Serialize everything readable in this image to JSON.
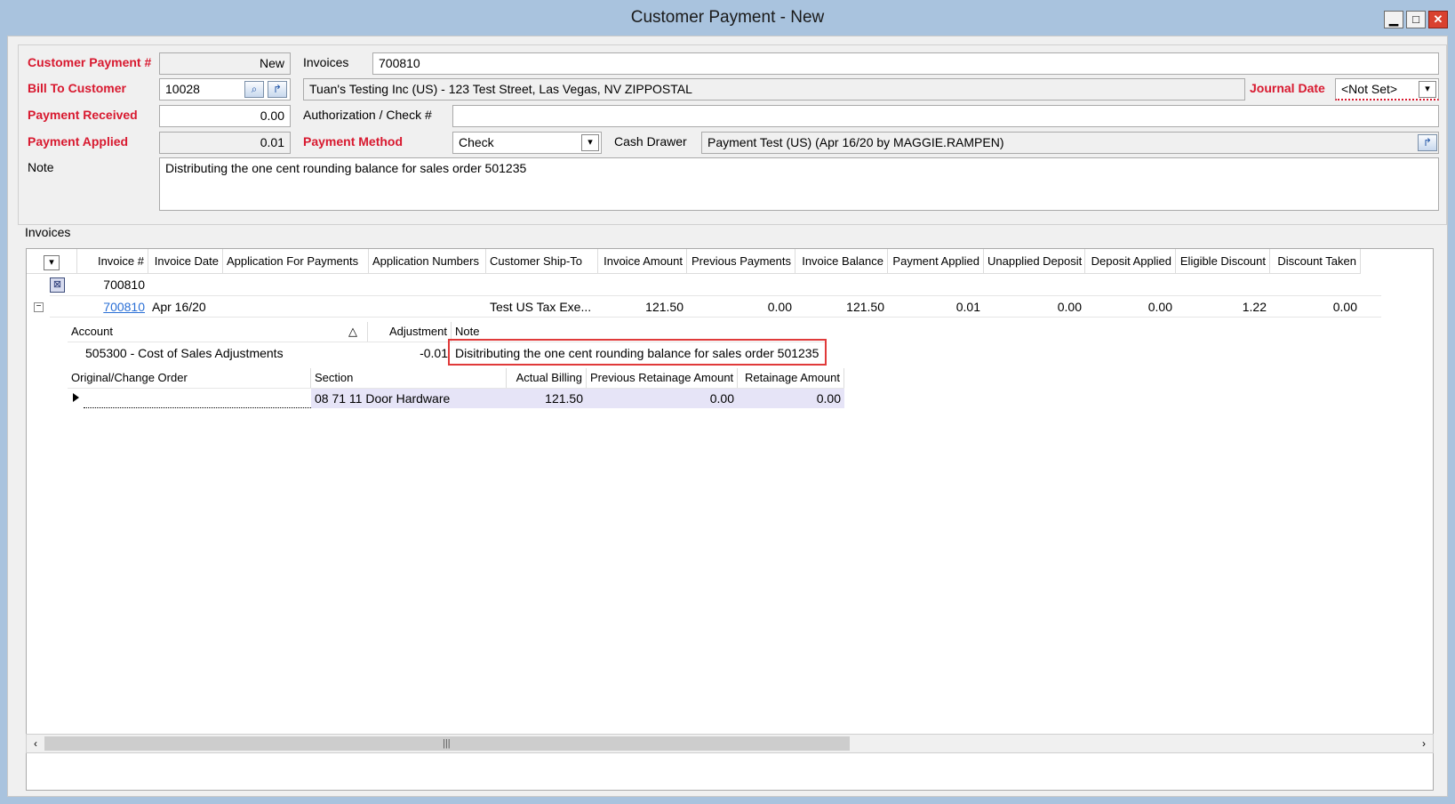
{
  "window": {
    "title": "Customer Payment - New",
    "minimize_icon": "minimize-icon",
    "maximize_icon": "maximize-icon",
    "close_icon": "close-icon"
  },
  "header": {
    "customer_payment_label": "Customer Payment #",
    "customer_payment_value": "New",
    "invoices_label": "Invoices",
    "invoices_value": "700810",
    "bill_to_label": "Bill To Customer",
    "bill_to_value": "10028",
    "bill_to_description": "Tuan's Testing Inc (US) - 123 Test Street, Las Vegas, NV  ZIPPOSTAL",
    "journal_date_label": "Journal Date",
    "journal_date_value": "<Not Set>",
    "payment_received_label": "Payment Received",
    "payment_received_value": "0.00",
    "authorization_label": "Authorization / Check #",
    "authorization_value": "",
    "payment_applied_label": "Payment Applied",
    "payment_applied_value": "0.01",
    "payment_method_label": "Payment Method",
    "payment_method_value": "Check",
    "cash_drawer_label": "Cash Drawer",
    "cash_drawer_value": "Payment Test (US) (Apr 16/20 by MAGGIE.RAMPEN)",
    "note_label": "Note",
    "note_value": "Distributing the one cent rounding balance for sales order 501235"
  },
  "invoices_section": {
    "title": "Invoices",
    "columns": [
      "Invoice #",
      "Invoice Date",
      "Application For Payments",
      "Application Numbers",
      "Customer Ship-To",
      "Invoice Amount",
      "Previous Payments",
      "Invoice Balance",
      "Payment Applied",
      "Unapplied Deposit",
      "Deposit Applied",
      "Eligible Discount",
      "Discount Taken"
    ],
    "filter_row": {
      "invoice": "700810"
    },
    "rows": [
      {
        "invoice": "700810",
        "invoice_date": "Apr 16/20",
        "application_for_payments": "",
        "application_numbers": "",
        "ship_to": "Test US Tax Exe...",
        "invoice_amount": "121.50",
        "previous_payments": "0.00",
        "invoice_balance": "121.50",
        "payment_applied": "0.01",
        "unapplied_deposit": "0.00",
        "deposit_applied": "0.00",
        "eligible_discount": "1.22",
        "discount_taken": "0.00"
      }
    ],
    "adjustments": {
      "columns": [
        "Account",
        "Adjustment",
        "Note"
      ],
      "rows": [
        {
          "account": "505300 - Cost of Sales Adjustments",
          "adjustment": "-0.01",
          "note": "Disitributing the one cent rounding balance for sales order 501235"
        }
      ]
    },
    "billing": {
      "columns": [
        "Original/Change Order",
        "Section",
        "Actual Billing",
        "Previous Retainage Amount",
        "Retainage Amount"
      ],
      "rows": [
        {
          "order": "",
          "section": "08 71 11 Door Hardware",
          "actual_billing": "121.50",
          "previous_retainage": "0.00",
          "retainage": "0.00"
        }
      ]
    }
  },
  "colors": {
    "required_label": "#d8192f",
    "highlight_box": "#e03a3a",
    "selected_row": "#e6e4f7",
    "link": "#2a6fd6"
  }
}
